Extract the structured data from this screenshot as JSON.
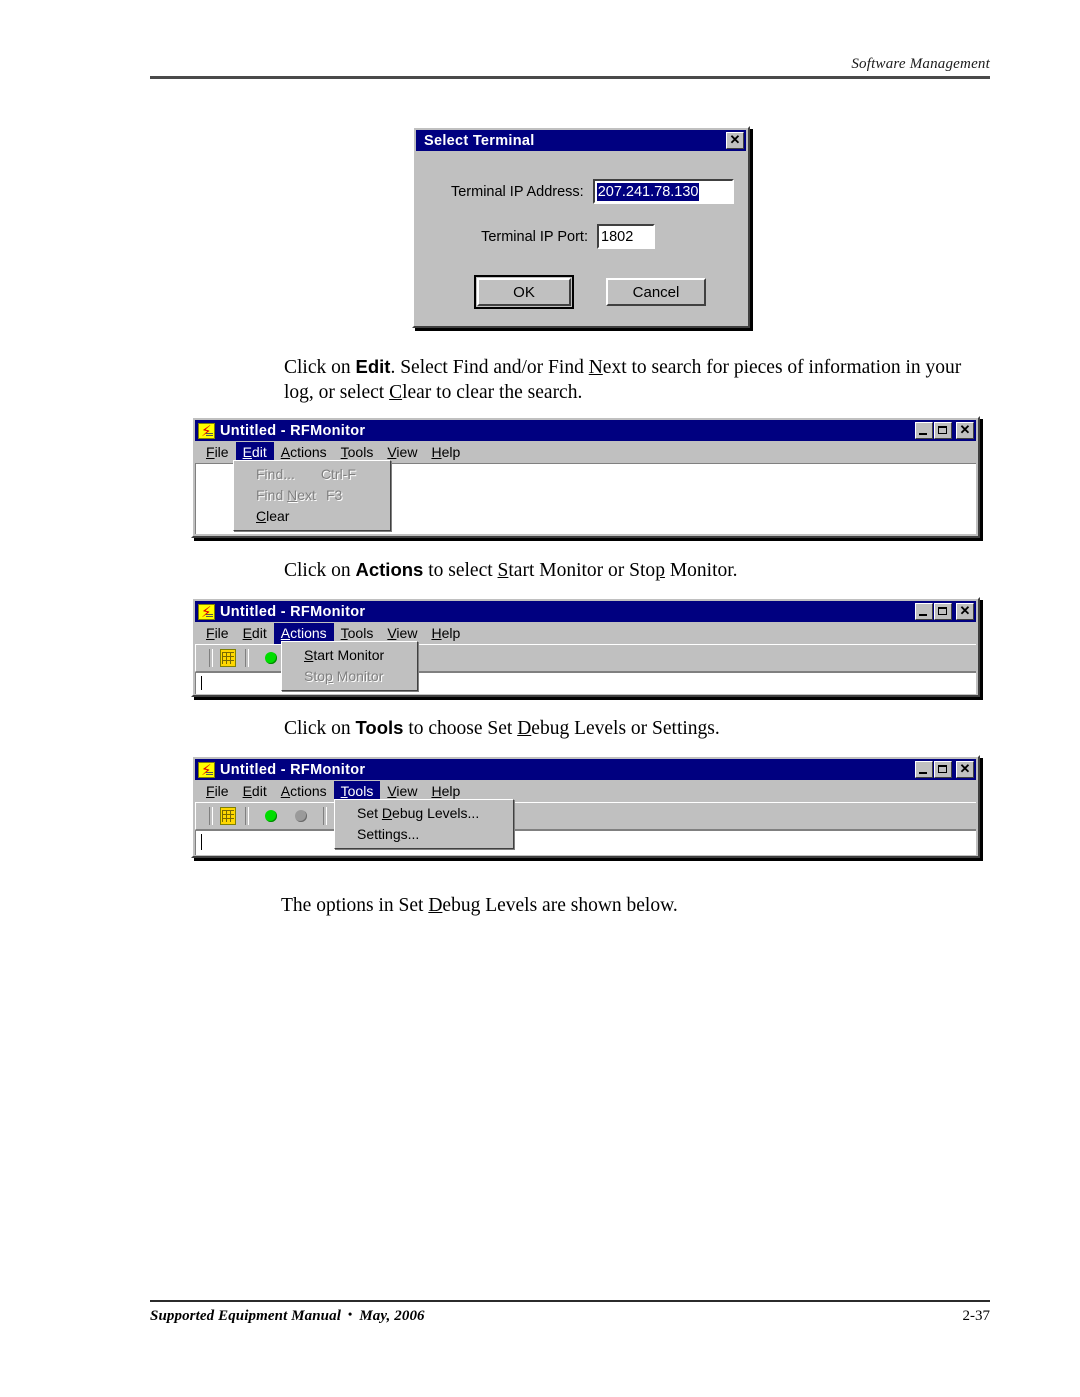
{
  "page": {
    "header_text": "Software Management",
    "footer_left": "Supported Equipment Manual",
    "footer_bullet": "•",
    "footer_date": "May, 2006",
    "footer_page": "2-37"
  },
  "paragraphs": {
    "p1_a": "Click on ",
    "p1_bold": "Edit",
    "p1_b": ". Select Find and/or Find ",
    "p1_u1": "N",
    "p1_c": "ext to search for pieces of information in your log, or select ",
    "p1_u2": "C",
    "p1_d": "lear to clear the search.",
    "p2_a": "Click on ",
    "p2_bold": "Actions",
    "p2_b": " to select ",
    "p2_u1": "S",
    "p2_c": "tart Monitor or Sto",
    "p2_u2": "p",
    "p2_d": " Monitor.",
    "p3_a": "Click on ",
    "p3_bold": "Tools",
    "p3_b": " to choose Set ",
    "p3_u1": "D",
    "p3_c": "ebug Levels or Settings.",
    "p4_a": "The options in Set ",
    "p4_u1": "D",
    "p4_b": "ebug Levels are shown below."
  },
  "dialog": {
    "title": "Select Terminal",
    "close_label": "✕",
    "ip_address_label": "Terminal IP Address:",
    "ip_address_value": "207.241.78.130",
    "ip_port_label": "Terminal IP Port:",
    "ip_port_value": "1802",
    "ok_label": "OK",
    "cancel_label": "Cancel"
  },
  "app": {
    "title": "Untitled - RFMonitor",
    "menus": [
      {
        "pre": "",
        "acc": "F",
        "post": "ile"
      },
      {
        "pre": "",
        "acc": "E",
        "post": "dit"
      },
      {
        "pre": "",
        "acc": "A",
        "post": "ctions"
      },
      {
        "pre": "",
        "acc": "T",
        "post": "ools"
      },
      {
        "pre": "",
        "acc": "V",
        "post": "iew"
      },
      {
        "pre": "",
        "acc": "H",
        "post": "elp"
      }
    ],
    "titlebar_buttons": {
      "minimize": "minimize",
      "maximize": "maximize",
      "close": "✕"
    }
  },
  "edit_menu": {
    "items": [
      {
        "pre": "Find...",
        "acc": "",
        "post": "",
        "accel": "Ctrl-F",
        "disabled": true
      },
      {
        "pre": "Find ",
        "acc": "N",
        "post": "ext",
        "accel": "F3",
        "disabled": true
      },
      {
        "pre": "",
        "acc": "C",
        "post": "lear",
        "accel": "",
        "disabled": false
      }
    ]
  },
  "actions_menu": {
    "items": [
      {
        "pre": "",
        "acc": "S",
        "post": "tart Monitor",
        "accel": "",
        "disabled": false
      },
      {
        "pre": "Sto",
        "acc": "p",
        "post": " Monitor",
        "accel": "",
        "disabled": true
      }
    ]
  },
  "tools_menu": {
    "items": [
      {
        "pre": "Set ",
        "acc": "D",
        "post": "ebug Levels...",
        "accel": "",
        "disabled": false
      },
      {
        "pre": "Settin",
        "acc": "g",
        "post": "s...",
        "accel": "",
        "disabled": false
      }
    ]
  },
  "toolbar": {
    "terminal_icon": "terminal-icon",
    "start_dot": "green-dot",
    "stop_dot": "gray-dot",
    "lines_icon": "lines-icon"
  }
}
